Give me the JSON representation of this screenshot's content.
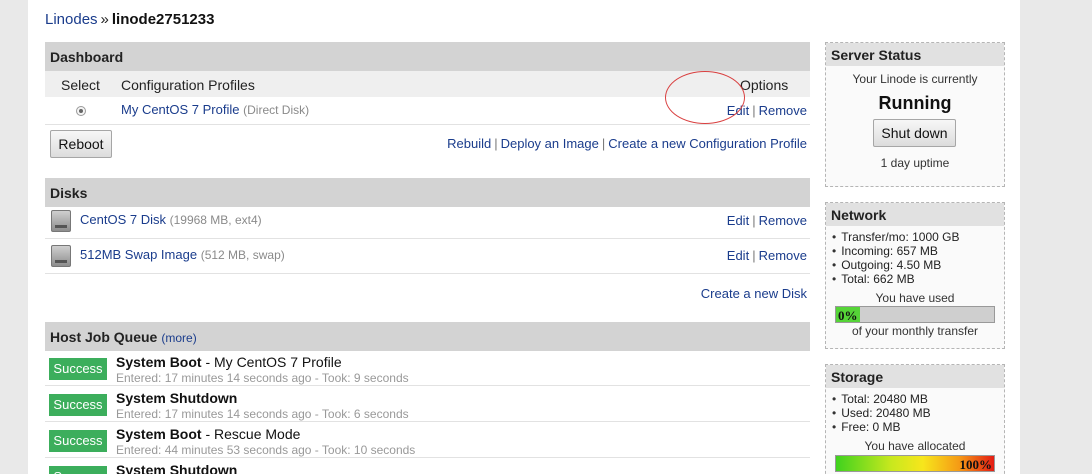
{
  "breadcrumb": {
    "parent": "Linodes",
    "separator": "»",
    "current": "linode2751233"
  },
  "dashboard": {
    "title": "Dashboard",
    "columns": {
      "select": "Select",
      "profiles": "Configuration Profiles",
      "options": "Options"
    },
    "profile": {
      "name": "My CentOS 7 Profile",
      "detail": "(Direct Disk)",
      "edit": "Edit",
      "remove": "Remove",
      "selected": true
    },
    "reboot_label": "Reboot",
    "actions": {
      "rebuild": "Rebuild",
      "deploy": "Deploy an Image",
      "create": "Create a new Configuration Profile"
    }
  },
  "disks": {
    "title": "Disks",
    "items": [
      {
        "name": "CentOS 7 Disk",
        "detail": "(19968 MB, ext4)",
        "edit": "Edit",
        "remove": "Remove"
      },
      {
        "name": "512MB Swap Image",
        "detail": "(512 MB, swap)",
        "edit": "Edit",
        "remove": "Remove"
      }
    ],
    "create_label": "Create a new Disk"
  },
  "jobs": {
    "title": "Host Job Queue",
    "more_label": "(more)",
    "items": [
      {
        "status": "Success",
        "name": "System Boot",
        "suffix": " - My CentOS 7 Profile",
        "detail": "Entered: 17 minutes 14 seconds ago - Took: 9 seconds"
      },
      {
        "status": "Success",
        "name": "System Shutdown",
        "suffix": "",
        "detail": "Entered: 17 minutes 14 seconds ago - Took: 6 seconds"
      },
      {
        "status": "Success",
        "name": "System Boot",
        "suffix": " - Rescue Mode",
        "detail": "Entered: 44 minutes 53 seconds ago - Took: 10 seconds"
      },
      {
        "status": "Success",
        "name": "System Shutdown",
        "suffix": "",
        "detail": ""
      }
    ]
  },
  "server_status": {
    "title": "Server Status",
    "intro": "Your Linode is currently",
    "state": "Running",
    "shutdown_label": "Shut down",
    "uptime": "1 day uptime"
  },
  "network": {
    "title": "Network",
    "items": [
      "Transfer/mo: 1000 GB",
      "Incoming: 657 MB",
      "Outgoing: 4.50 MB",
      "Total: 662 MB"
    ],
    "used_label": "You have used",
    "percent_label": "0%",
    "percent_value": 0.0,
    "footer": "of your monthly transfer"
  },
  "storage": {
    "title": "Storage",
    "items": [
      "Total: 20480 MB",
      "Used: 20480 MB",
      "Free: 0 MB"
    ],
    "allocated_label": "You have allocated",
    "percent_label": "100%",
    "percent_value": 1.0
  },
  "colors": {
    "link": "#1a3c8c",
    "success": "#3cae5c",
    "section_header": "#d3d3d3"
  }
}
